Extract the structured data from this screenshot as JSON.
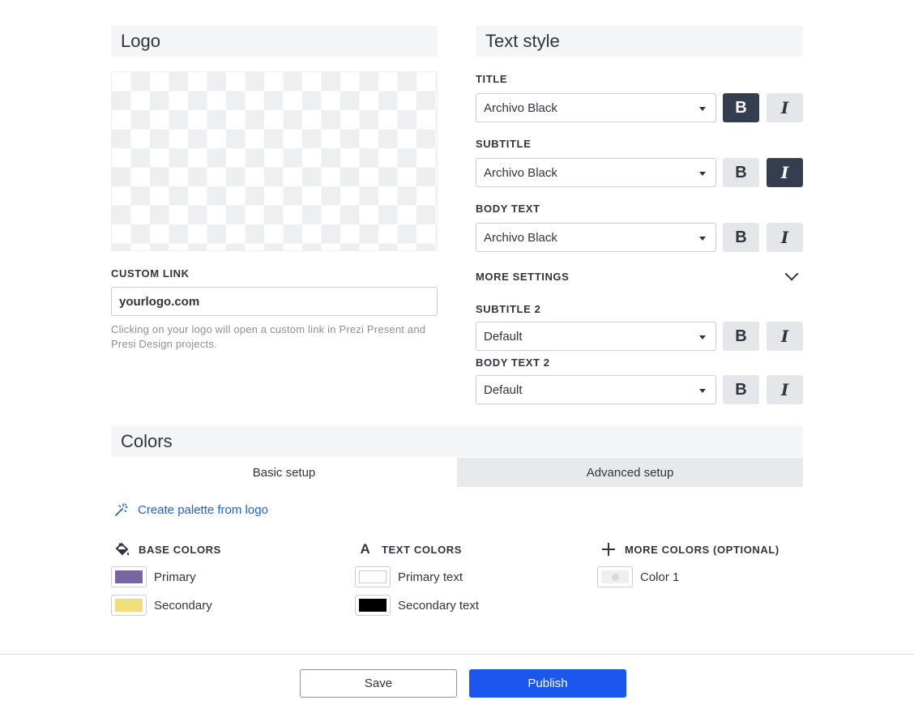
{
  "logo": {
    "heading": "Logo",
    "custom_link_label": "CUSTOM LINK",
    "custom_link_value": "yourlogo.com",
    "custom_link_help": "Clicking on your logo will open a custom link in Prezi Present and Presi Design projects."
  },
  "text_style": {
    "heading": "Text style",
    "rows": [
      {
        "label": "TITLE",
        "font": "Archivo Black",
        "bold": true,
        "italic": false
      },
      {
        "label": "SUBTITLE",
        "font": "Archivo Black",
        "bold": false,
        "italic": true
      },
      {
        "label": "BODY TEXT",
        "font": "Archivo Black",
        "bold": false,
        "italic": false
      }
    ],
    "more_settings_label": "MORE SETTINGS",
    "more_rows": [
      {
        "label": "SUBTITLE 2",
        "font": "Default",
        "bold": false,
        "italic": false
      },
      {
        "label": "BODY TEXT 2",
        "font": "Default",
        "bold": false,
        "italic": false
      }
    ],
    "bold_glyph": "B",
    "italic_glyph": "I"
  },
  "colors": {
    "heading": "Colors",
    "tabs": {
      "basic": "Basic setup",
      "advanced": "Advanced setup"
    },
    "create_palette_label": "Create palette from logo",
    "base": {
      "heading": "BASE COLORS",
      "items": [
        {
          "label": "Primary",
          "color": "#7866a3"
        },
        {
          "label": "Secondary",
          "color": "#f1dd7c"
        }
      ]
    },
    "text": {
      "heading": "TEXT COLORS",
      "items": [
        {
          "label": "Primary text",
          "color": "#ffffff"
        },
        {
          "label": "Secondary text",
          "color": "#000000"
        }
      ]
    },
    "more": {
      "heading": "MORE COLORS (OPTIONAL)",
      "items": [
        {
          "label": "Color 1",
          "color": "#eeeff1"
        }
      ]
    }
  },
  "footer": {
    "save_label": "Save",
    "publish_label": "Publish"
  },
  "accent_color": "#1b57ee"
}
